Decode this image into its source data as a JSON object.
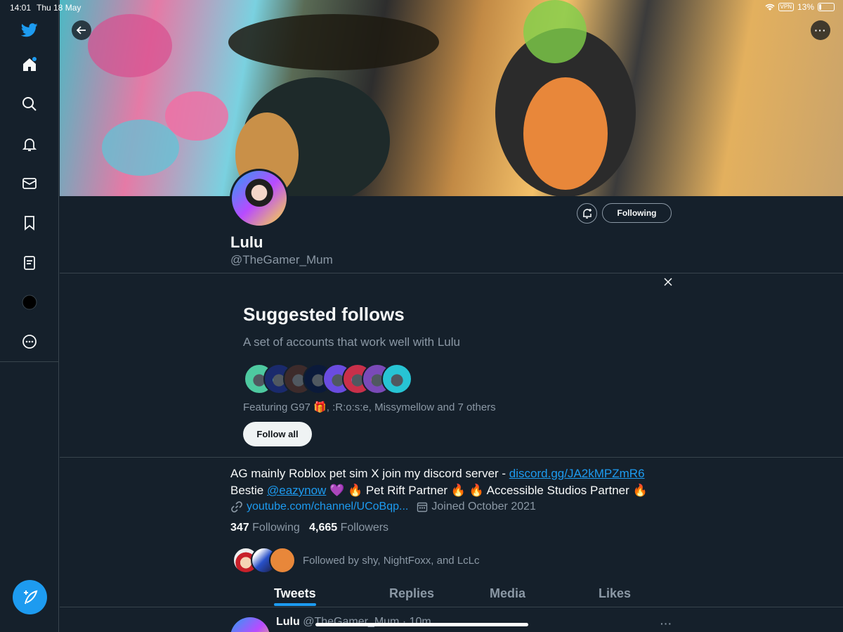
{
  "status_bar": {
    "time": "14:01",
    "date": "Thu 18 May",
    "vpn": "VPN",
    "battery": "13%"
  },
  "sidebar": {
    "items": [
      {
        "icon": "twitter-logo-icon"
      },
      {
        "icon": "home-icon"
      },
      {
        "icon": "search-icon"
      },
      {
        "icon": "notifications-bell-icon"
      },
      {
        "icon": "messages-envelope-icon"
      },
      {
        "icon": "bookmark-icon"
      },
      {
        "icon": "lists-icon"
      },
      {
        "icon": "profile-avatar-icon"
      },
      {
        "icon": "more-circle-icon"
      }
    ],
    "compose_icon": "compose-tweet-icon"
  },
  "profile": {
    "display_name": "Lulu",
    "handle": "@TheGamer_Mum",
    "following_button": "Following",
    "more_button": "···",
    "bio_line1_text": "AG mainly Roblox pet sim X join my discord server - ",
    "bio_line1_link": "discord.gg/JA2kMPZmR6",
    "bio_line2_pre": "Bestie ",
    "bio_line2_mention": "@eazynow",
    "bio_line2_post": " 💜 🔥 Pet Rift Partner 🔥 🔥 Accessible Studios Partner 🔥",
    "website": "youtube.com/channel/UCoBqp...",
    "joined": "Joined October 2021",
    "following_count": "347",
    "following_label": "Following",
    "followers_count": "4,665",
    "followers_label": "Followers",
    "followed_by": "Followed by shy, NightFoxx, and LcLc"
  },
  "suggested": {
    "title": "Suggested follows",
    "subtitle": "A set of accounts that work well with Lulu",
    "featuring": "Featuring G97 🎁, :R:o:s:e, Missymellow and 7 others",
    "follow_all": "Follow all",
    "avatar_colors": [
      "#4ec9a0",
      "#1a2a6c",
      "#3d2b2b",
      "#0b1a3a",
      "#6a4ce0",
      "#c9304a",
      "#7a4ab8",
      "#27c4d4"
    ]
  },
  "tabs": [
    {
      "label": "Tweets",
      "active": true
    },
    {
      "label": "Replies",
      "active": false
    },
    {
      "label": "Media",
      "active": false
    },
    {
      "label": "Likes",
      "active": false
    }
  ],
  "tweet_preview": {
    "name": "Lulu",
    "handle_time": "@TheGamer_Mum · 10m",
    "more": "···"
  },
  "colors": {
    "accent": "#1d9bf0",
    "background": "#15202b",
    "muted": "#8b98a5",
    "border": "#38444d"
  }
}
